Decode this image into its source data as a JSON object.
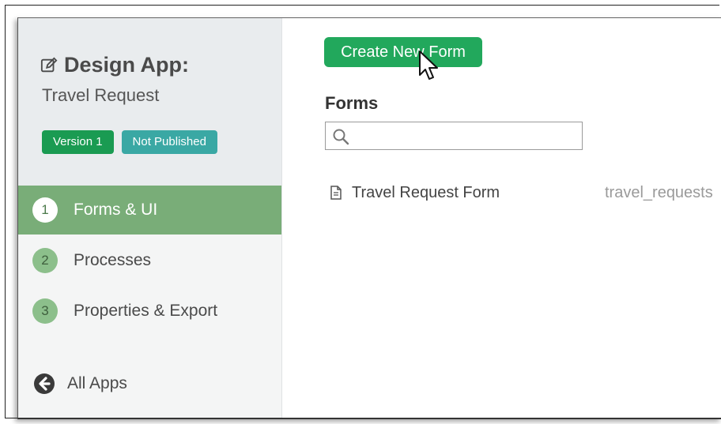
{
  "sidebar": {
    "app_title": "Design App:",
    "app_name": "Travel Request",
    "badges": {
      "version": "Version 1",
      "status": "Not Published"
    },
    "nav": [
      {
        "num": "1",
        "label": "Forms & UI",
        "active": true
      },
      {
        "num": "2",
        "label": "Processes",
        "active": false
      },
      {
        "num": "3",
        "label": "Properties & Export",
        "active": false
      }
    ],
    "all_apps_label": "All Apps"
  },
  "main": {
    "create_button_label": "Create New Form",
    "forms_heading": "Forms",
    "search": {
      "value": "",
      "placeholder": ""
    },
    "forms": [
      {
        "name": "Travel Request Form",
        "table": "travel_requests"
      }
    ]
  },
  "icons": {
    "edit": "edit-icon",
    "search": "search-icon",
    "document": "document-icon",
    "back": "arrow-left-circle-icon",
    "cursor": "mouse-pointer-icon"
  },
  "colors": {
    "primary_green": "#22a85c",
    "active_nav": "#79ad78",
    "version_badge": "#1a9b52",
    "status_badge": "#3aa8a4"
  }
}
